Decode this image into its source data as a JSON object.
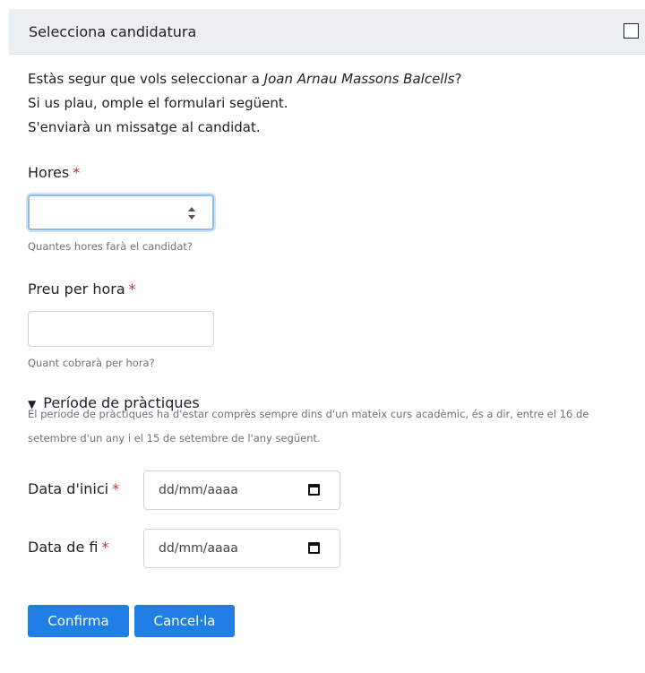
{
  "dialog": {
    "title": "Selecciona candidatura",
    "intro_prefix": "Estàs segur que vols seleccionar a ",
    "candidate_name": "Joan Arnau Massons Balcells",
    "intro_suffix": "?",
    "line2": "Si us plau, omple el formulari següent.",
    "line3": "S'enviarà un missatge al candidat."
  },
  "form": {
    "required_mark": "*",
    "hours": {
      "label": "Hores",
      "value": "",
      "help": "Quantes hores farà el candidat?"
    },
    "price": {
      "label": "Preu per hora",
      "value": "",
      "help": "Quant cobrarà per hora?"
    },
    "period": {
      "title": "Període de pràctiques",
      "description": "El període de pràctiques ha d'estar comprès sempre dins d'un mateix curs acadèmic, és a dir, entre el 16 de setembre d'un any i el 15 de setembre de l'any següent.",
      "start": {
        "label": "Data d'inici",
        "placeholder": "dd/mm/aaaa"
      },
      "end": {
        "label": "Data de fi",
        "placeholder": "dd/mm/aaaa"
      }
    }
  },
  "buttons": {
    "confirm": "Confirma",
    "cancel": "Cancel·la"
  },
  "colors": {
    "accent": "#1f7fe5",
    "required": "#c9302c",
    "header_bg": "#eceff1"
  }
}
